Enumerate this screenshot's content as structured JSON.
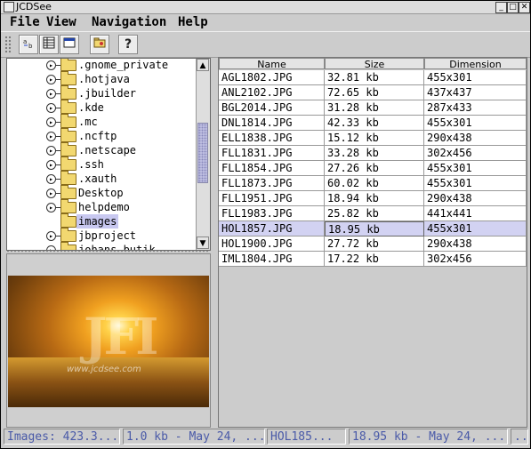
{
  "window": {
    "title": "JCDSee",
    "buttons": [
      "_",
      "□",
      "✕"
    ]
  },
  "menubar": {
    "items": [
      {
        "label": "File"
      },
      {
        "label": "View"
      },
      {
        "label": "Navigation"
      },
      {
        "label": "Help"
      }
    ]
  },
  "toolbar": {
    "icons": [
      "details-view-icon",
      "list-view-icon",
      "preview-window-icon",
      "open-folder-icon",
      "help-icon"
    ],
    "help_glyph": "?"
  },
  "tree": {
    "items": [
      {
        "label": ".gnome_private",
        "expander": true
      },
      {
        "label": ".hotjava",
        "expander": true
      },
      {
        "label": ".jbuilder",
        "expander": true
      },
      {
        "label": ".kde",
        "expander": true
      },
      {
        "label": ".mc",
        "expander": true
      },
      {
        "label": ".ncftp",
        "expander": true
      },
      {
        "label": ".netscape",
        "expander": true
      },
      {
        "label": ".ssh",
        "expander": true
      },
      {
        "label": ".xauth",
        "expander": true
      },
      {
        "label": "Desktop",
        "expander": true
      },
      {
        "label": "helpdemo",
        "expander": true
      },
      {
        "label": "images",
        "expander": false,
        "selected": true
      },
      {
        "label": "jbproject",
        "expander": true
      },
      {
        "label": "johans_butik",
        "expander": true
      }
    ]
  },
  "preview": {
    "watermark": "JFI",
    "url": "www.jcdsee.com"
  },
  "table": {
    "columns": [
      "Name",
      "Size",
      "Dimension"
    ],
    "rows": [
      {
        "name": "AGL1802.JPG",
        "size": "32.81 kb",
        "dim": "455x301"
      },
      {
        "name": "ANL2102.JPG",
        "size": "72.65 kb",
        "dim": "437x437"
      },
      {
        "name": "BGL2014.JPG",
        "size": "31.28 kb",
        "dim": "287x433"
      },
      {
        "name": "DNL1814.JPG",
        "size": "42.33 kb",
        "dim": "455x301"
      },
      {
        "name": "ELL1838.JPG",
        "size": "15.12 kb",
        "dim": "290x438"
      },
      {
        "name": "FLL1831.JPG",
        "size": "33.28 kb",
        "dim": "302x456"
      },
      {
        "name": "FLL1854.JPG",
        "size": "27.26 kb",
        "dim": "455x301"
      },
      {
        "name": "FLL1873.JPG",
        "size": "60.02 kb",
        "dim": "455x301"
      },
      {
        "name": "FLL1951.JPG",
        "size": "18.94 kb",
        "dim": "290x438"
      },
      {
        "name": "FLL1983.JPG",
        "size": "25.82 kb",
        "dim": "441x441"
      },
      {
        "name": "HOL1857.JPG",
        "size": "18.95 kb",
        "dim": "455x301",
        "selected": true
      },
      {
        "name": "HOL1900.JPG",
        "size": "27.72 kb",
        "dim": "290x438"
      },
      {
        "name": "IML1804.JPG",
        "size": "17.22 kb",
        "dim": "302x456"
      }
    ]
  },
  "statusbar": {
    "images": "Images: 423.3...",
    "folder": "1.0 kb - May 24, ...",
    "file": "HOL185...",
    "file_info": "18.95 kb - May 24, ...",
    "extra": "..."
  },
  "colors": {
    "selection": "#d2d2f2",
    "status_text": "#4a5aa8",
    "folder": "#f2d870"
  }
}
